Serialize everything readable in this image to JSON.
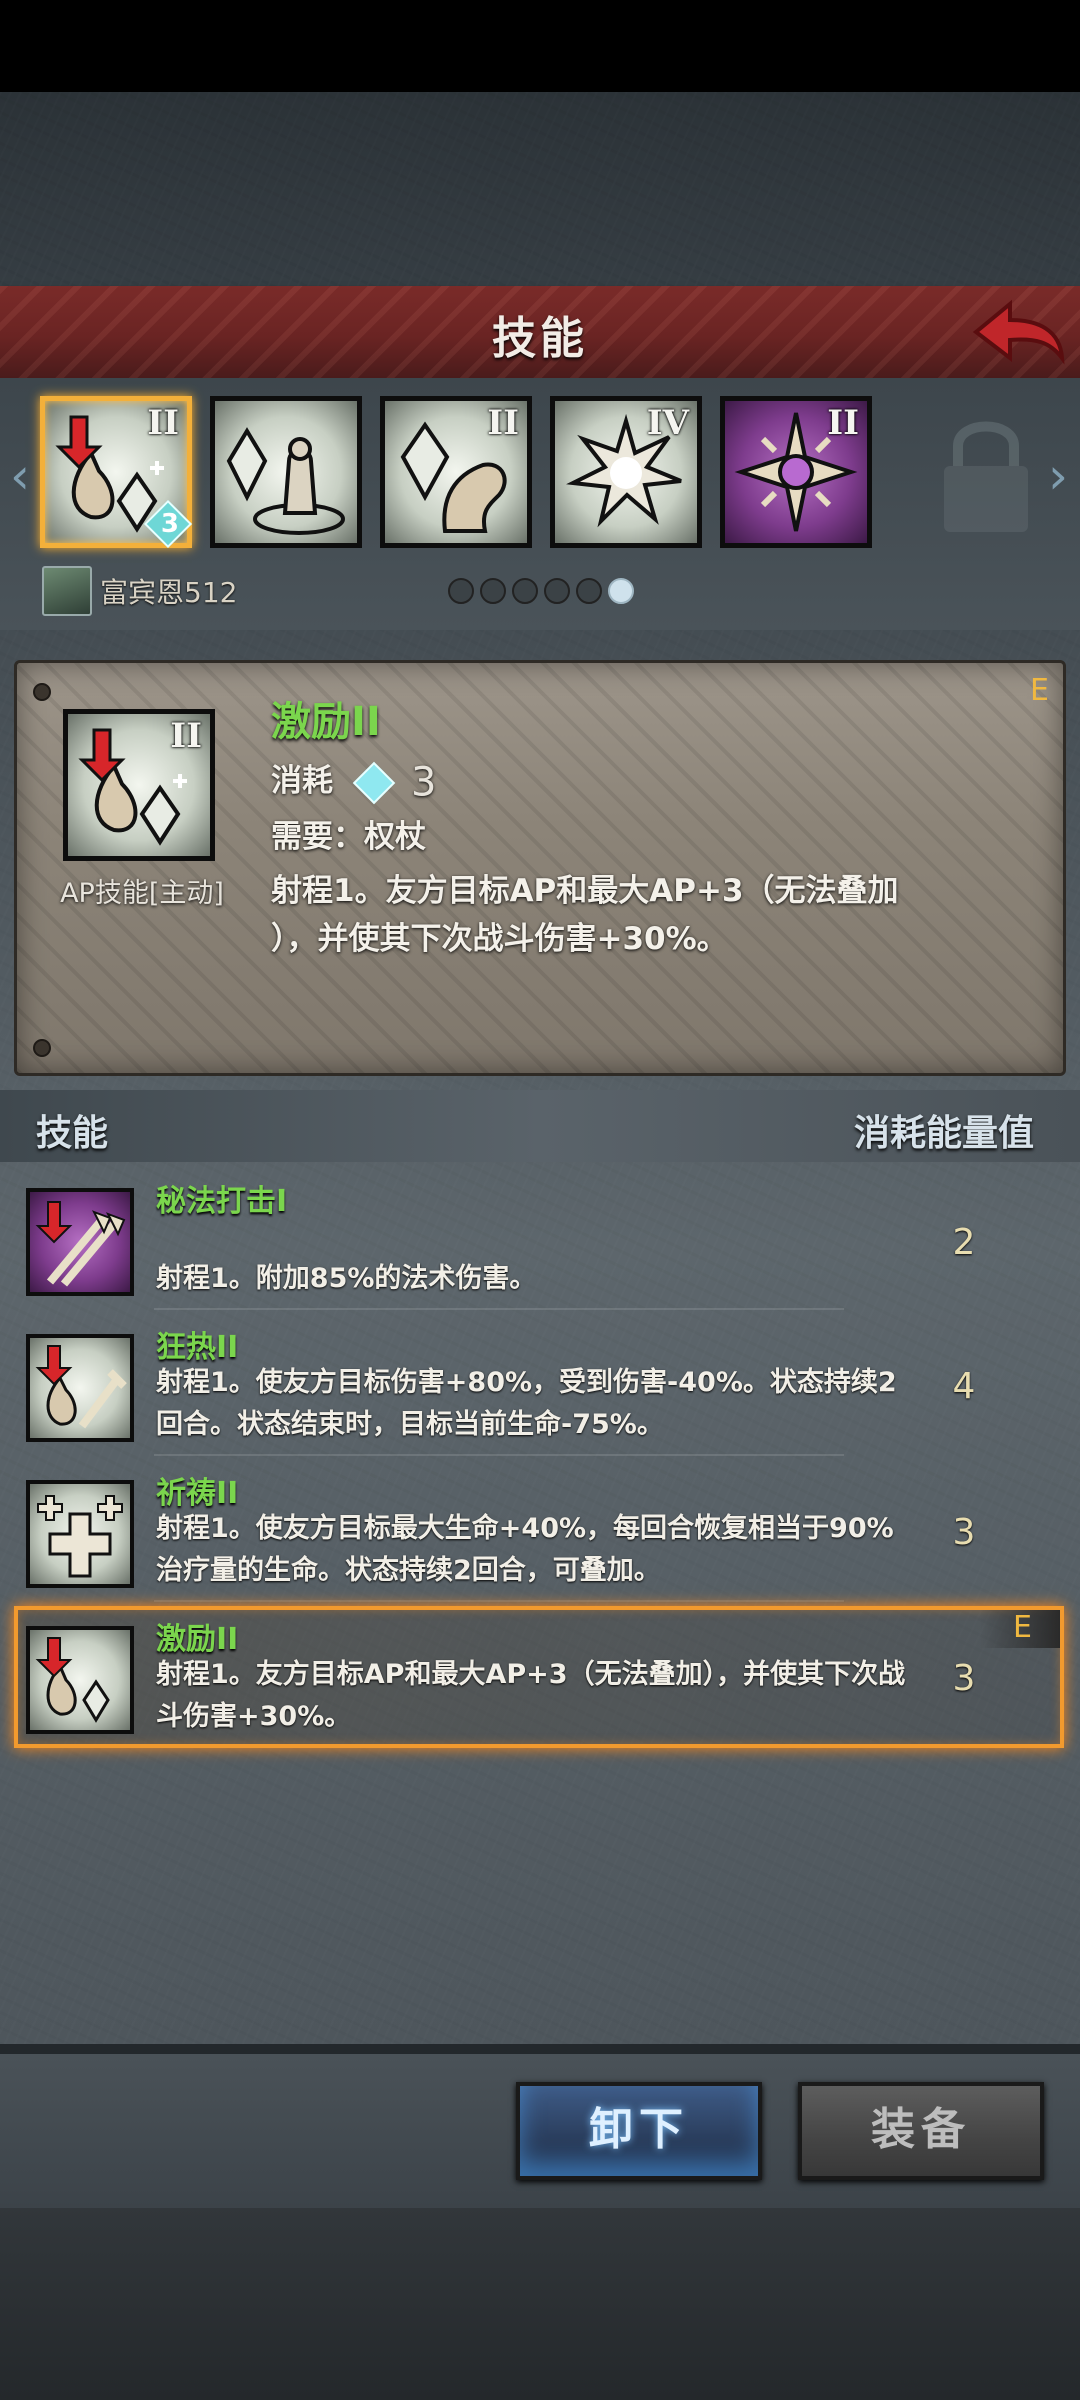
{
  "header": {
    "title": "技能"
  },
  "skill_slots": [
    {
      "icon": "drop-diamond-arrow-icon",
      "level": "II",
      "badge": "3",
      "selected": true
    },
    {
      "icon": "pillar-figure-icon",
      "level": "",
      "selected": false
    },
    {
      "icon": "diamond-hand-icon",
      "level": "II",
      "selected": false
    },
    {
      "icon": "shatter-burst-icon",
      "level": "IV",
      "selected": false
    },
    {
      "icon": "star-crosshair-icon",
      "level": "II",
      "selected": false
    }
  ],
  "owner": {
    "name": "富宾恩512"
  },
  "pager": {
    "total": 6,
    "active_index": 5
  },
  "detail": {
    "name": "激励II",
    "type": "AP技能[主动]",
    "cost_label": "消耗",
    "cost_value": "3",
    "requirement": "需要：权杖",
    "desc_line1": "射程1。友方目标AP和最大AP+3（无法叠加",
    "desc_line2": "），并使其下次战斗伤害+30%。",
    "grade": "E",
    "level": "II"
  },
  "list_header": {
    "left": "技能",
    "right": "消耗能量值"
  },
  "skills": [
    {
      "name": "秘法打击I",
      "desc": "射程1。附加85%的法术伤害。",
      "cost": "2"
    },
    {
      "name": "狂热II",
      "desc": "射程1。使友方目标伤害+80%，受到伤害-40%。状态持续2回合。状态结束时，目标当前生命-75%。",
      "cost": "4"
    },
    {
      "name": "祈祷II",
      "desc": "射程1。使友方目标最大生命+40%，每回合恢复相当于90%治疗量的生命。状态持续2回合，可叠加。",
      "cost": "3"
    },
    {
      "name": "激励II",
      "desc": "射程1。友方目标AP和最大AP+3（无法叠加），并使其下次战斗伤害+30%。",
      "cost": "3",
      "grade": "E"
    }
  ],
  "buttons": {
    "unequip": "卸下",
    "equip": "装备"
  },
  "colors": {
    "header_red": "#6a2423",
    "skill_name_green": "#7bd64d",
    "selected_orange": "#f29a2e",
    "unequip_blue": "#2a3d5c"
  }
}
